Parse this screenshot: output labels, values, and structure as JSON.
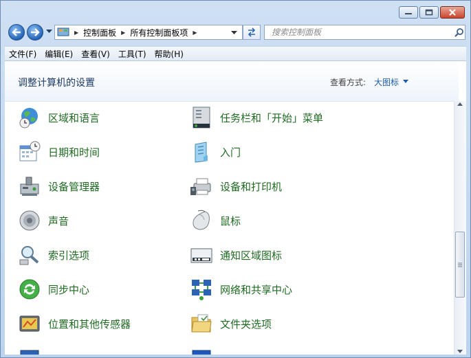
{
  "window": {
    "caption_buttons": [
      "minimize-icon",
      "maximize-icon",
      "close-icon"
    ]
  },
  "address": {
    "crumbs": [
      "控制面板",
      "所有控制面板项"
    ]
  },
  "search": {
    "placeholder": "搜索控制面板"
  },
  "menu": [
    "文件(F)",
    "编辑(E)",
    "查看(V)",
    "工具(T)",
    "帮助(H)"
  ],
  "header": {
    "title": "调整计算机的设置",
    "view_label": "查看方式:",
    "view_value": "大图标"
  },
  "items": [
    {
      "label": "区域和语言",
      "icon": "globe-clock-icon"
    },
    {
      "label": "任务栏和「开始」菜单",
      "icon": "taskbar-icon"
    },
    {
      "label": "日期和时间",
      "icon": "calendar-clock-icon"
    },
    {
      "label": "入门",
      "icon": "getting-started-icon"
    },
    {
      "label": "设备管理器",
      "icon": "device-manager-icon"
    },
    {
      "label": "设备和打印机",
      "icon": "printer-icon"
    },
    {
      "label": "声音",
      "icon": "speaker-icon"
    },
    {
      "label": "鼠标",
      "icon": "mouse-icon"
    },
    {
      "label": "索引选项",
      "icon": "magnifier-icon"
    },
    {
      "label": "通知区域图标",
      "icon": "notification-icon"
    },
    {
      "label": "同步中心",
      "icon": "sync-icon"
    },
    {
      "label": "网络和共享中心",
      "icon": "network-icon"
    },
    {
      "label": "位置和其他传感器",
      "icon": "sensor-icon"
    },
    {
      "label": "文件夹选项",
      "icon": "folder-icon"
    }
  ],
  "colors": {
    "link": "#1f6b22",
    "accent": "#1e5aa8"
  }
}
